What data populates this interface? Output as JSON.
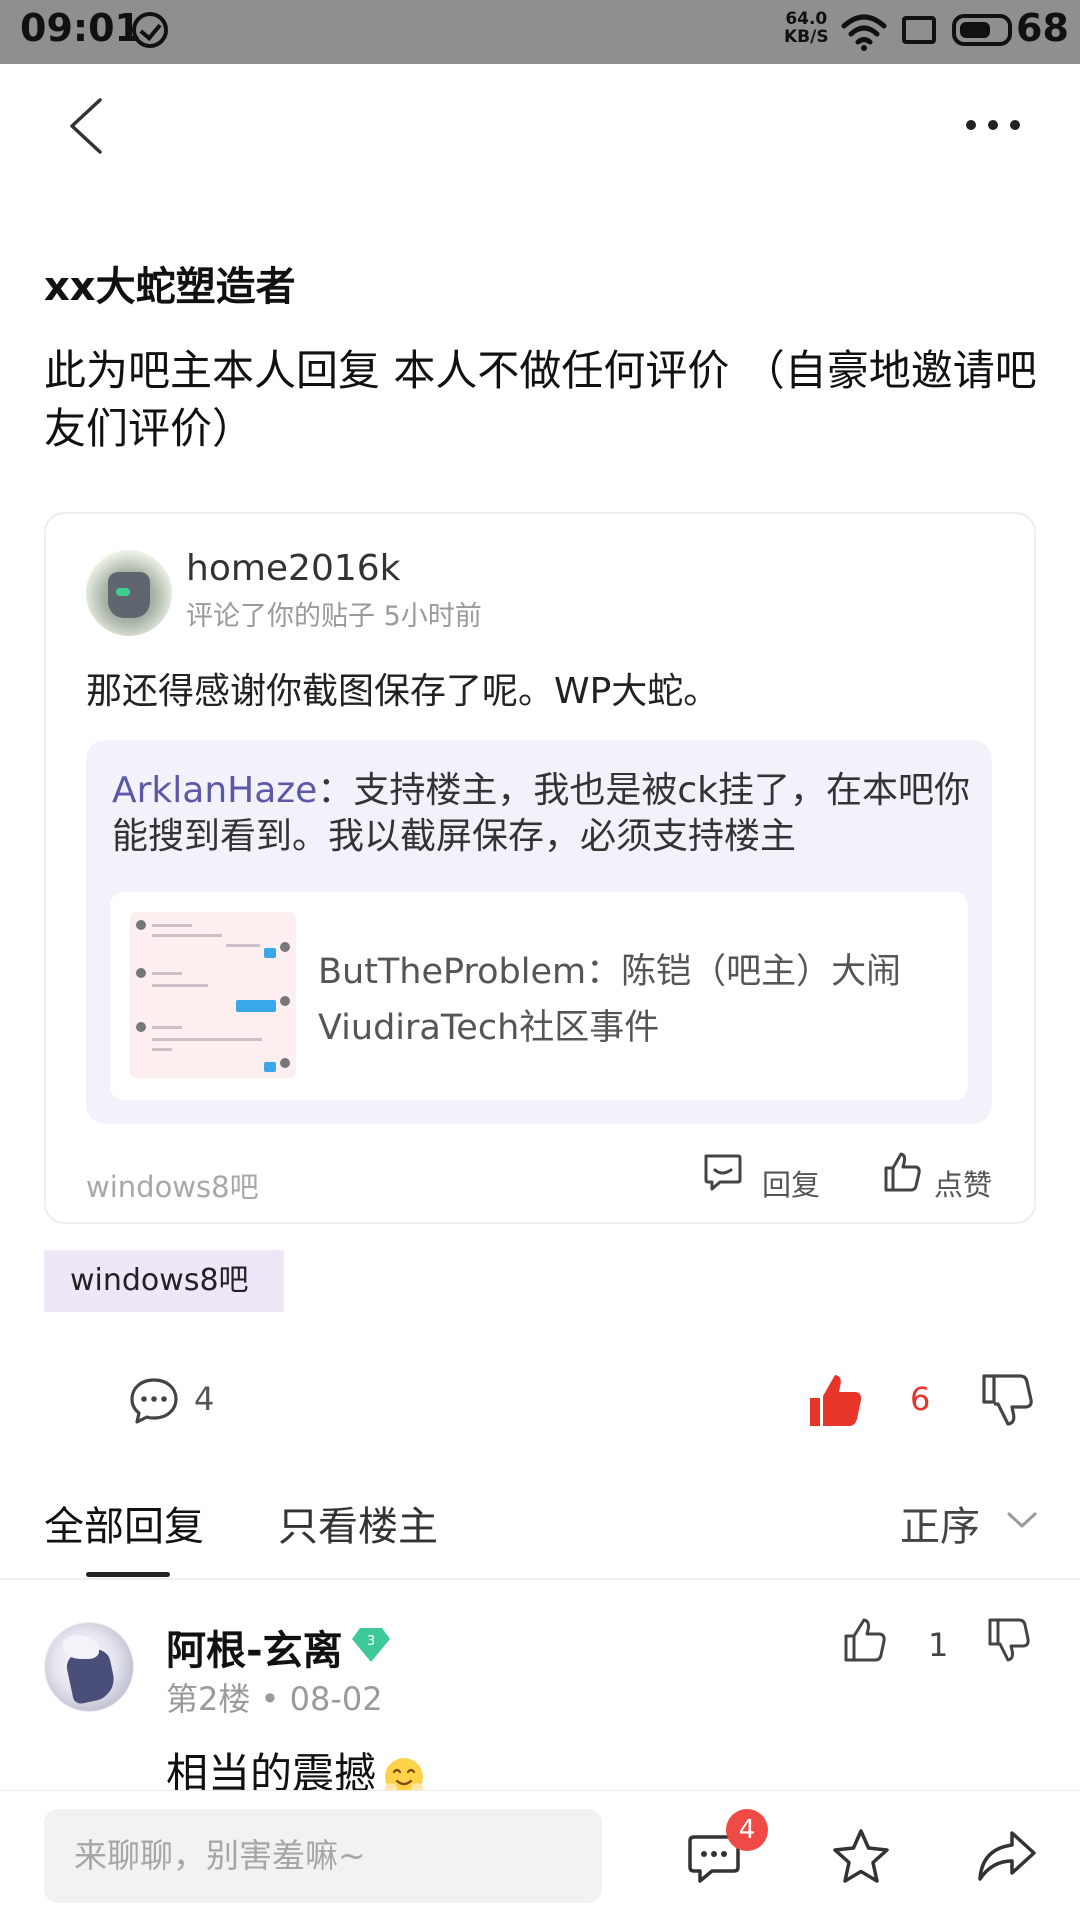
{
  "status_bar": {
    "time": "09:01",
    "speed_value": "64.0",
    "speed_unit": "KB/S",
    "battery": "68",
    "battery_level": 0.68
  },
  "post": {
    "author": "xx大蛇塑造者",
    "text": "此为吧主本人回复 本人不做任何评价 （自豪地邀请吧友们评价）",
    "embedded": {
      "user": "home2016k",
      "meta": "评论了你的贴子  5小时前",
      "comment": "那还得感谢你截图保存了呢。WP大蛇。",
      "quote_name": "ArklanHaze",
      "quote_text": "：支持楼主，我也是被ck挂了，在本吧你能搜到看到。我以截屏保存，必须支持楼主",
      "link_title": "ButTheProblem：陈铠（吧主）大闹ViudiraTech社区事件",
      "forum": "windows8吧",
      "reply_label": "回复",
      "like_label": "点赞"
    },
    "tag": "windows8吧",
    "comment_count": "4",
    "like_count": "6"
  },
  "tabs": {
    "all": "全部回复",
    "owner_only": "只看楼主",
    "sort": "正序"
  },
  "reply": {
    "name": "阿根-玄离",
    "level": "3",
    "meta": "第2楼 • 08-02",
    "like_count": "1",
    "text": "相当的震撼"
  },
  "bottom_bar": {
    "input_placeholder": "来聊聊，别害羞嘛~",
    "message_badge": "4"
  },
  "colors": {
    "accent_red": "#e8352a",
    "quote_name": "#5b58a8",
    "tag_bg": "#efe6f8",
    "badge_green": "#3ec99a"
  }
}
